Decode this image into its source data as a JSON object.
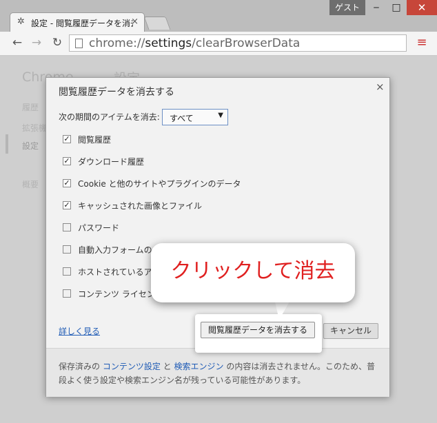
{
  "window": {
    "guest_label": "ゲスト",
    "minimize_glyph": "‒",
    "maximize_glyph": "□",
    "close_glyph": "✕"
  },
  "tab": {
    "icon": "gear-icon",
    "title": "設定 - 閲覧履歴データを消去",
    "close_glyph": "×"
  },
  "toolbar": {
    "back_glyph": "←",
    "forward_glyph": "→",
    "reload_glyph": "↻",
    "url_scheme": "chrome://",
    "url_host": "settings",
    "url_path": "/clearBrowserData",
    "menu_glyph": "≡"
  },
  "background_page": {
    "brand": "Chrome",
    "heading": "設定",
    "nav_items": [
      "履歴",
      "拡張機能",
      "設定",
      "概要"
    ]
  },
  "dialog": {
    "title": "閲覧履歴データを消去する",
    "close_glyph": "×",
    "period_label": "次の期間のアイテムを消去:",
    "period_value": "すべて",
    "options": [
      {
        "label": "閲覧履歴",
        "checked": true
      },
      {
        "label": "ダウンロード履歴",
        "checked": true
      },
      {
        "label": "Cookie と他のサイトやプラグインのデータ",
        "checked": true
      },
      {
        "label": "キャッシュされた画像とファイル",
        "checked": true
      },
      {
        "label": "パスワード",
        "checked": false
      },
      {
        "label": "自動入力フォームのデータ",
        "checked": false
      },
      {
        "label": "ホストされているアプリのデータ",
        "checked": false
      },
      {
        "label": "コンテンツ ライセンス",
        "checked": false
      }
    ],
    "learn_more": "詳しく見る",
    "clear_button": "閲覧履歴データを消去する",
    "cancel_button": "キャンセル",
    "footer": {
      "part1": "保存済みの ",
      "link1": "コンテンツ設定",
      "part2": " と ",
      "link2": "検索エンジン",
      "part3": " の内容は消去されません。このため、普段よく使う設定や検索エンジン名が残っている可能性があります。"
    }
  },
  "annotation": {
    "callout_text": "クリックして消去",
    "callout_color": "#e02020"
  }
}
